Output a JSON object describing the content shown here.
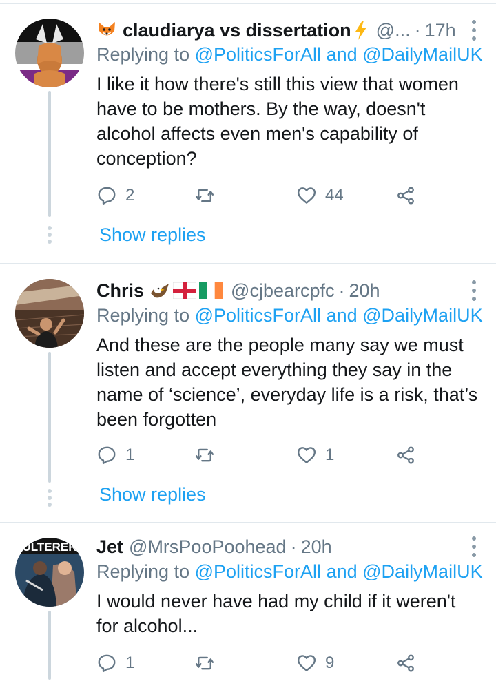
{
  "tweets": [
    {
      "name": "claudiarya vs dissertation",
      "handle": "@...",
      "time": "17h",
      "replying_prefix": "Replying to",
      "replying_to_1": "@PoliticsForAll",
      "replying_and": "and",
      "replying_to_2": "@DailyMailUK",
      "text": "I like it how there's still this view that women have to be mothers. By the way, doesn't alcohol affects even men's capability of conception?",
      "reply_count": "2",
      "retweet_count": "",
      "like_count": "44",
      "show_replies": "Show replies"
    },
    {
      "name": "Chris",
      "handle": "@cjbearcpfc",
      "time": "20h",
      "replying_prefix": "Replying to",
      "replying_to_1": "@PoliticsForAll",
      "replying_and": "and",
      "replying_to_2": "@DailyMailUK",
      "text": "And these are the people many say we must listen and accept everything they say in the name of ‘science’, everyday life is a risk, that’s been forgotten",
      "reply_count": "1",
      "retweet_count": "",
      "like_count": "1",
      "show_replies": "Show replies"
    },
    {
      "name": "Jet",
      "handle": "@MrsPooPoohead",
      "time": "20h",
      "replying_prefix": "Replying to",
      "replying_to_1": "@PoliticsForAll",
      "replying_and": "and",
      "replying_to_2": "@DailyMailUK",
      "text": "I would never have had my child if it weren't for alcohol...",
      "reply_count": "1",
      "retweet_count": "",
      "like_count": "9",
      "avatar_text": "ULTERER"
    }
  ],
  "separator_dot": "·",
  "colors": {
    "accent": "#1da1f2",
    "secondary_text": "#657786",
    "thread_line": "#ccd6dd"
  }
}
